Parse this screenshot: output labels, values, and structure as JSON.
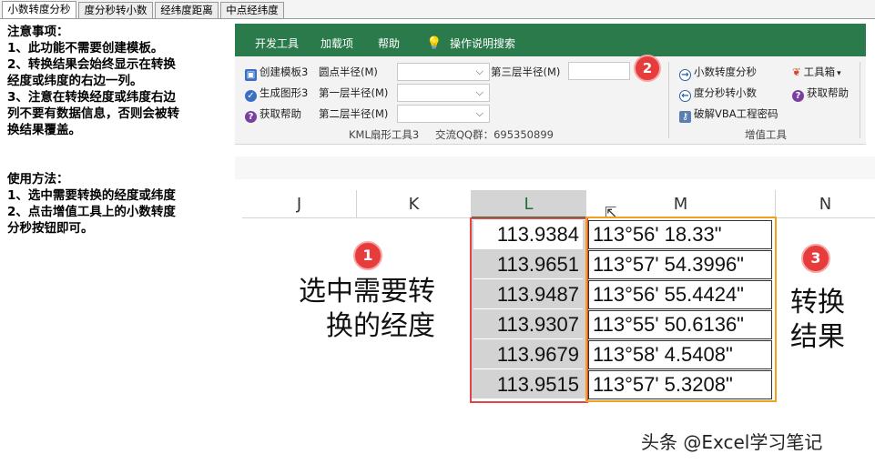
{
  "tabs": [
    "小数转度分秒",
    "度分秒转小数",
    "经纬度距离",
    "中点经纬度"
  ],
  "notes": {
    "heading": "注意事项：",
    "items": [
      "1、此功能不需要创建模板。",
      "2、转换结果会始终显示在转换",
      "经度或纬度的右边一列。",
      "3、注意在转换经度或纬度右边",
      "列不要有数据信息，否则会被转",
      "换结果覆盖。"
    ],
    "usage_heading": "使用方法：",
    "usage_items": [
      "1、选中需要转换的经度或纬度",
      "2、点击增值工具上的小数转度",
      "分秒按钮即可。"
    ]
  },
  "ribbon": {
    "tabs": [
      "开发工具",
      "加载项",
      "帮助",
      "操作说明搜索"
    ],
    "buttons": {
      "create_template": "创建模板3",
      "generate_shape": "生成图形3",
      "get_help": "获取帮助",
      "dot_radius": "圆点半径(M)",
      "layer1_radius": "第一层半径(M)",
      "layer2_radius": "第二层半径(M)",
      "layer3_radius": "第三层半径(M)",
      "dec_to_dms": "小数转度分秒",
      "dms_to_dec": "度分秒转小数",
      "crack_vba": "破解VBA工程密码",
      "toolbox": "工具箱",
      "get_help2": "获取帮助"
    },
    "group_footer": "KML扇形工具3",
    "qq_group": "交流QQ群：695350899",
    "addon_group": "增值工具"
  },
  "columns": [
    "J",
    "K",
    "L",
    "M",
    "N"
  ],
  "table": {
    "L": [
      "113.9384",
      "113.9651",
      "113.9487",
      "113.9307",
      "113.9679",
      "113.9515"
    ],
    "M": [
      "113°56' 18.33\"",
      "113°57' 54.3996\"",
      "113°56' 55.4424\"",
      "113°55' 50.6136\"",
      "113°58' 4.5408\"",
      "113°57' 5.3208\""
    ]
  },
  "callouts": [
    "1",
    "2",
    "3"
  ],
  "annotations": {
    "left_line1": "选中需要转",
    "left_line2": "换的经度",
    "right_line1": "转换",
    "right_line2": "结果"
  },
  "watermark": "头条 @Excel学习笔记",
  "colors": {
    "ribbon_green": "#2b7a4b",
    "red_box": "#e64545",
    "orange_box": "#f0a020",
    "callout_red": "#e63c3c"
  }
}
